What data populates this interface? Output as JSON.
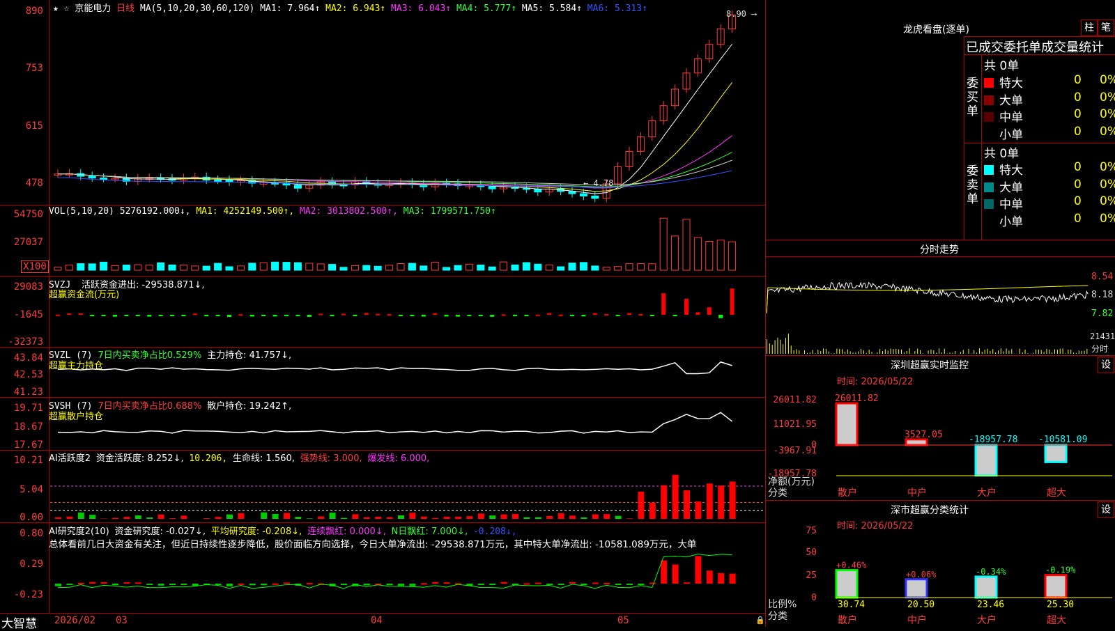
{
  "header": {
    "stock_name": "京能电力",
    "period": "日线",
    "ma_prefix": "MA(5,10,20,30,60,120)",
    "ma": [
      {
        "label": "MA1: 7.964↑",
        "color": "#ffffff"
      },
      {
        "label": "MA2: 6.943↑",
        "color": "#ffff00"
      },
      {
        "label": "MA3: 6.043↑",
        "color": "#ff33ff"
      },
      {
        "label": "MA4: 5.777↑",
        "color": "#33ff33"
      },
      {
        "label": "MA5: 5.584↑",
        "color": "#ffffff"
      },
      {
        "label": "MA6: 5.313↑",
        "color": "#3355ff"
      }
    ]
  },
  "price_axis": [
    "890",
    "753",
    "615",
    "478"
  ],
  "price_annotations": {
    "high": "8.90",
    "low": "4.78"
  },
  "vol": {
    "title": "VOL(5,10,20)",
    "value": "5276192.000↓,",
    "ma1": "MA1: 4252149.500↑,",
    "ma2": "MA2: 3013802.500↑,",
    "ma3": "MA3: 1799571.750↑",
    "axis": [
      "54750",
      "27037",
      "X100"
    ]
  },
  "svzj": {
    "title": "SVZJ",
    "line1": "活跃资金进出: -29538.871↓,",
    "line2": "超赢资金流(万元)",
    "axis": [
      "29083",
      "-1645",
      "-32373"
    ]
  },
  "svzl": {
    "title": "SVZL (7)",
    "part1": "7日内买卖净占比0.529%",
    "part2": "主力持仓: 41.757↓,",
    "line2": "超赢主力持仓",
    "axis": [
      "43.84",
      "42.53",
      "41.23"
    ]
  },
  "svsh": {
    "title": "SVSH (7)",
    "part1": "7日内买卖净占比0.688%",
    "part2": "散户持仓: 19.242↑,",
    "line2": "超赢散户持仓",
    "axis": [
      "19.71",
      "18.67",
      "17.67"
    ]
  },
  "ai2": {
    "title": "AI活跃度2",
    "a": "资金活跃度: 8.252↓,",
    "b": "10.206,",
    "c": "生命线: 1.560,",
    "d": "强势线: 3.000,",
    "e": "爆发线: 6.000,",
    "axis": [
      "10.21",
      "5.04",
      "0.00"
    ]
  },
  "ai_research": {
    "title": "AI研究度2(10)",
    "a": "资金研究度: -0.027↓,",
    "b": "平均研究度: -0.208↓,",
    "c": "连续飘红: 0.000↓,",
    "d": "N日飘红: 7.000↓,",
    "e": "-0.208↓,",
    "summary": "总体看前几日大资金有关注，但近日持续性逐步降低，股价面临方向选择，今日大单净流出: -29538.871万元，其中特大单净流出: -10581.089万元，大单",
    "axis": [
      "0.80",
      "0.29",
      "-0.23"
    ]
  },
  "bottom_axis": {
    "brand": "大智慧",
    "labels": [
      "2026/02",
      "03",
      "04",
      "05"
    ]
  },
  "right": {
    "dragon_title": "龙虎看盘(逐单)",
    "btn_bar": "柱",
    "btn_pen": "笔",
    "tabs": "已成交委托单成交量统计",
    "buy_label": "委买单",
    "sell_label": "委卖单",
    "buy_total": "共 0单",
    "sell_total": "共 0单",
    "buy_rows": [
      {
        "name": "特大",
        "count": "0",
        "pct": "0%",
        "color": "#ff0000"
      },
      {
        "name": "大单",
        "count": "0",
        "pct": "0%",
        "color": "#8b0000"
      },
      {
        "name": "中单",
        "count": "0",
        "pct": "0%",
        "color": "#5a0000"
      },
      {
        "name": "小单",
        "count": "0",
        "pct": "0%",
        "color": "#000000"
      }
    ],
    "sell_rows": [
      {
        "name": "特大",
        "count": "0",
        "pct": "0%",
        "color": "#00ffff"
      },
      {
        "name": "大单",
        "count": "0",
        "pct": "0%",
        "color": "#008b8b"
      },
      {
        "name": "中单",
        "count": "0",
        "pct": "0%",
        "color": "#006666"
      },
      {
        "name": "小单",
        "count": "0",
        "pct": "0%",
        "color": "#000000"
      }
    ],
    "intraday_title": "分时走势",
    "intraday_axis": [
      "8.54",
      "8.18",
      "7.82",
      "21431",
      "分时"
    ],
    "monitor_title": "深圳超赢实时监控",
    "monitor_time": "时间: 2026/05/22",
    "monitor_axis": [
      "26011.82",
      "11021.95",
      "0",
      "-3967.91",
      "-18957.78"
    ],
    "monitor_unit": "净额(万元)",
    "monitor_unit2": "分类",
    "monitor_bars": [
      {
        "name": "散户",
        "value": "26011.82"
      },
      {
        "name": "中户",
        "value": "3527.05"
      },
      {
        "name": "大户",
        "value": "-18957.78"
      },
      {
        "name": "超大",
        "value": "-10581.09"
      }
    ],
    "class_title": "深市超赢分类统计",
    "class_time": "时间: 2026/05/22",
    "class_axis": [
      "75",
      "50",
      "25",
      "0"
    ],
    "class_unit": "比例%",
    "class_unit2": "分类",
    "class_bars": [
      {
        "name": "散户",
        "change": "+0.46%",
        "value": "30.74"
      },
      {
        "name": "中户",
        "change": "+0.06%",
        "value": "20.50"
      },
      {
        "name": "大户",
        "change": "-0.34%",
        "value": "23.46"
      },
      {
        "name": "超大",
        "change": "-0.19%",
        "value": "25.30"
      }
    ],
    "settings_label": "设"
  }
}
